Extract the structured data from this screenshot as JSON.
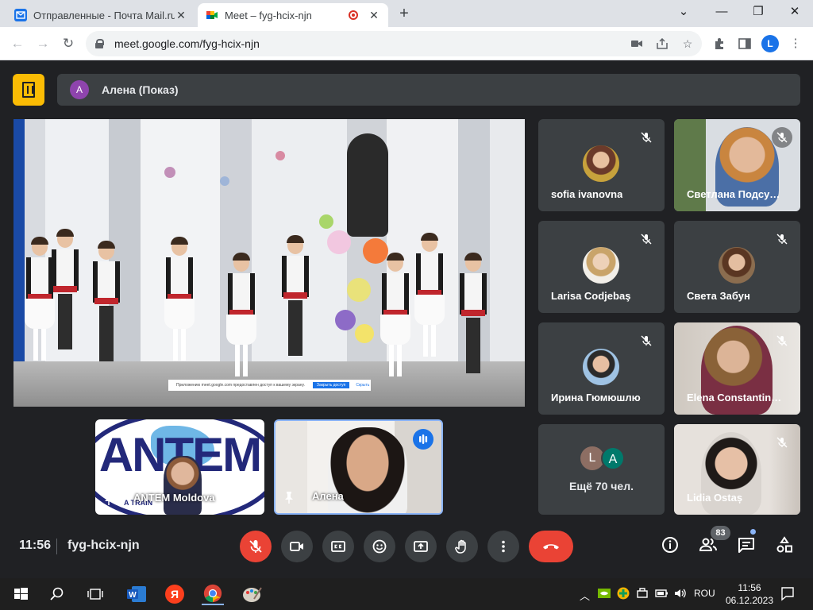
{
  "browser": {
    "tabs": [
      {
        "title": "Отправленные - Почта Mail.ru",
        "close": "✕"
      },
      {
        "title": "Meet – fyg-hcix-njn",
        "close": "✕"
      }
    ],
    "new_tab": "+",
    "window_controls": [
      "⌄",
      "—",
      "❐",
      "✕"
    ],
    "url": "meet.google.com/fyg-hcix-njn",
    "profile_initial": "L"
  },
  "meet": {
    "presenter": {
      "initial": "A",
      "label": "Алена (Показ)"
    },
    "screen_notice": {
      "text": "Приложению meet.google.com предоставлен доступ к вашему экрану.",
      "button": "Закрыть доступ",
      "hide": "Скрыть"
    },
    "participants": [
      {
        "name": "sofia ivanovna",
        "muted": true
      },
      {
        "name": "Светлана Подсу…",
        "muted": true
      },
      {
        "name": "Larisa Codjebaş",
        "muted": true
      },
      {
        "name": "Света Забун",
        "muted": true
      },
      {
        "name": "Ирина Гюмюшлю",
        "muted": true
      },
      {
        "name": "Elena Constantin…",
        "muted": true
      },
      {
        "name": "Lidia Ostaș",
        "muted": true
      }
    ],
    "more": {
      "avatars": [
        "L",
        "A"
      ],
      "label": "Ещё 70 чел."
    },
    "pinned": [
      {
        "name": "ANTEM Moldova",
        "logo_text": "ANTEM",
        "sub_text": "A TRAIN"
      },
      {
        "name": "Алена"
      }
    ],
    "controls": {
      "time": "11:56",
      "meeting_code": "fyg-hcix-njn",
      "people_count": "83"
    },
    "colors": {
      "accent": "#fbbc04",
      "hangup": "#ea4335",
      "panel": "#3c4043",
      "speaking": "#8ab4f8"
    }
  },
  "taskbar": {
    "language": "ROU",
    "time": "11:56",
    "date": "06.12.2023"
  }
}
